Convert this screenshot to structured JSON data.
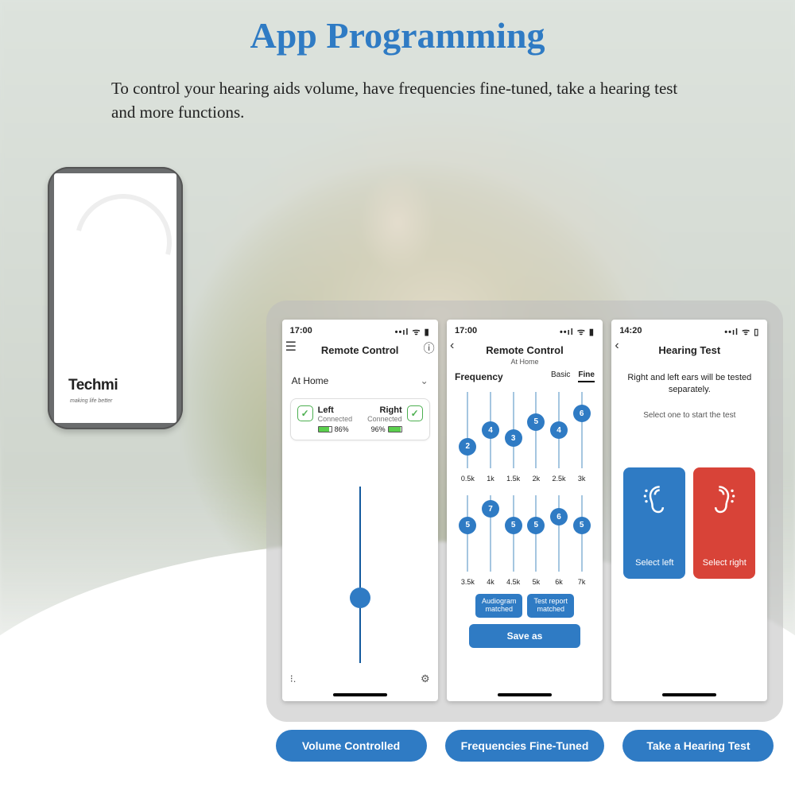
{
  "title": "App Programming",
  "subtitle": "To control your hearing aids volume, have frequencies fine-tuned, take a hearing test and more functions.",
  "held_phone": {
    "brand": "Techmi",
    "tagline": "making life better"
  },
  "captions": [
    "Volume Controlled",
    "Frequencies Fine-Tuned",
    "Take a Hearing Test"
  ],
  "screen1": {
    "time": "17:00",
    "title": "Remote Control",
    "preset": "At Home",
    "left": {
      "name": "Left",
      "status": "Connected",
      "pct": "86%"
    },
    "right": {
      "name": "Right",
      "status": "Connected",
      "pct": "96%"
    }
  },
  "screen2": {
    "time": "17:00",
    "title": "Remote Control",
    "subtitle": "At Home",
    "freq_label": "Frequency",
    "tabs": {
      "basic": "Basic",
      "fine": "Fine"
    },
    "row1": {
      "vals": [
        2,
        4,
        3,
        5,
        4,
        6
      ],
      "labels": [
        "0.5k",
        "1k",
        "1.5k",
        "2k",
        "2.5k",
        "3k"
      ]
    },
    "row2": {
      "vals": [
        5,
        7,
        5,
        5,
        6,
        5
      ],
      "labels": [
        "3.5k",
        "4k",
        "4.5k",
        "5k",
        "6k",
        "7k"
      ]
    },
    "btn1": "Audiogram\nmatched",
    "btn2": "Test report\nmatched",
    "save": "Save as"
  },
  "screen3": {
    "time": "14:20",
    "title": "Hearing Test",
    "line1": "Right and left ears will be tested separately.",
    "line2": "Select one to start the test",
    "left": "Select left",
    "right": "Select right"
  },
  "chart_data": [
    {
      "type": "bar",
      "title": "Frequency EQ (low band)",
      "categories": [
        "0.5k",
        "1k",
        "1.5k",
        "2k",
        "2.5k",
        "3k"
      ],
      "values": [
        2,
        4,
        3,
        5,
        4,
        6
      ],
      "ylim": [
        0,
        8
      ]
    },
    {
      "type": "bar",
      "title": "Frequency EQ (high band)",
      "categories": [
        "3.5k",
        "4k",
        "4.5k",
        "5k",
        "6k",
        "7k"
      ],
      "values": [
        5,
        7,
        5,
        5,
        6,
        5
      ],
      "ylim": [
        0,
        8
      ]
    }
  ]
}
